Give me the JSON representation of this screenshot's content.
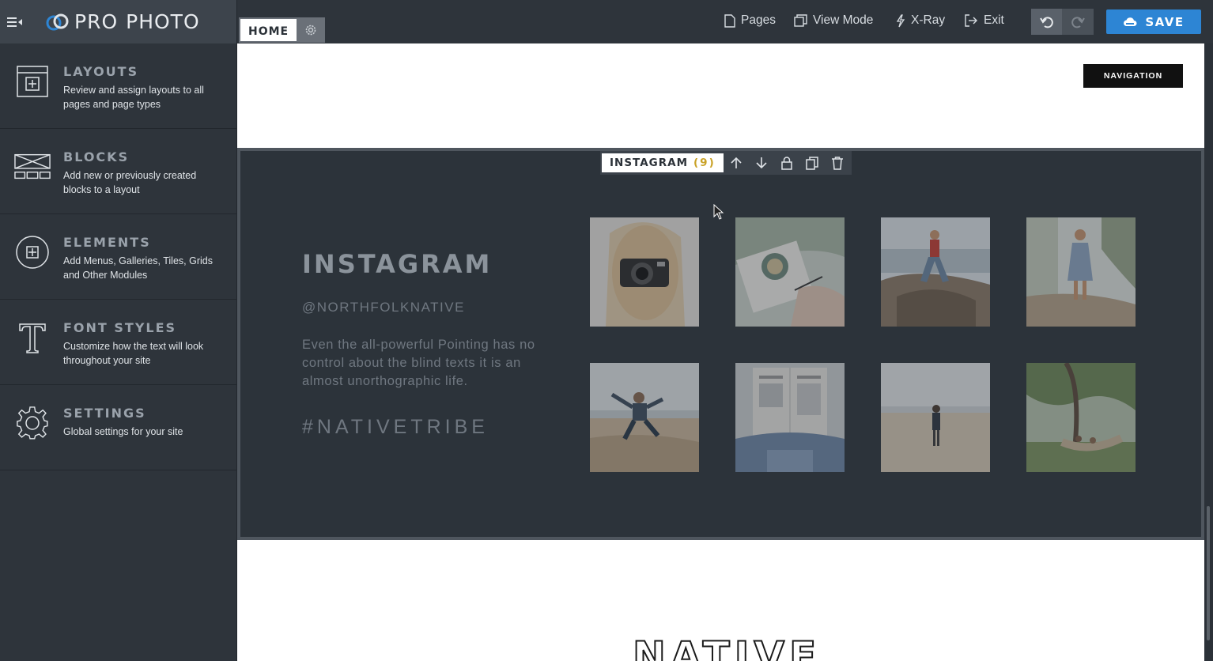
{
  "app": {
    "brand_left": "PRO",
    "brand_right": "PHOTO",
    "accent_color": "#2d85d4"
  },
  "sidebar": {
    "items": [
      {
        "title": "LAYOUTS",
        "desc": "Review and assign layouts to all pages and page types",
        "icon": "layout-icon"
      },
      {
        "title": "BLOCKS",
        "desc": "Add new or previously created blocks to a layout",
        "icon": "blocks-icon"
      },
      {
        "title": "ELEMENTS",
        "desc": "Add Menus, Galleries, Tiles, Grids and Other Modules",
        "icon": "plus-circle-icon"
      },
      {
        "title": "FONT STYLES",
        "desc": "Customize how the text will look throughout your site",
        "icon": "font-icon"
      },
      {
        "title": "SETTINGS",
        "desc": "Global settings for your site",
        "icon": "gear-icon"
      }
    ]
  },
  "topbar": {
    "page_tab": "HOME",
    "pages_label": "Pages",
    "view_mode_label": "View Mode",
    "xray_label": "X-Ray",
    "exit_label": "Exit",
    "save_label": "SAVE"
  },
  "canvas": {
    "nav_button": "NAVIGATION",
    "block_toolbar": {
      "label": "INSTAGRAM",
      "count": "(9)"
    },
    "instagram": {
      "title": "INSTAGRAM",
      "handle": "@NORTHFOLKNATIVE",
      "text": "Even the all-powerful Pointing has no control about the blind texts it is an almost unorthographic life.",
      "hashtag": "#NATIVETRIBE"
    },
    "footer_logo": "NATIVE"
  }
}
